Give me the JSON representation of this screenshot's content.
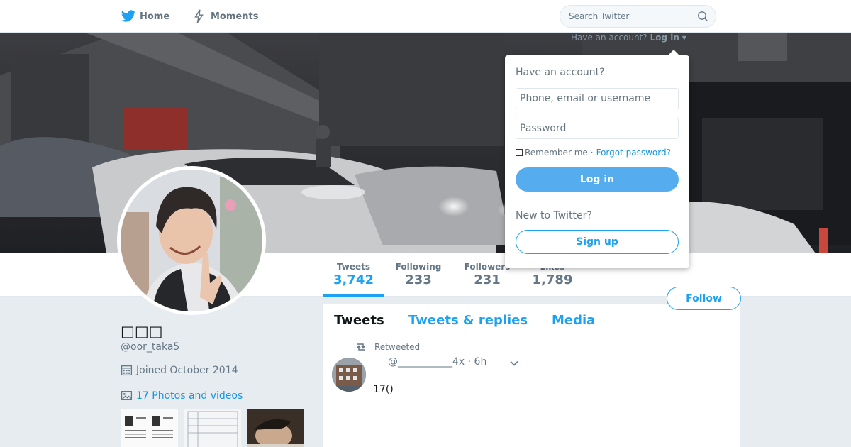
{
  "nav": {
    "home_label": "Home",
    "moments_label": "Moments",
    "search_placeholder": "Search Twitter",
    "login_prompt": "Have an account?",
    "login_link": "Log in"
  },
  "profile": {
    "name": "□□□",
    "handle": "@oor_taka5",
    "joined": "Joined October 2014",
    "photos_link": "17 Photos and videos",
    "follow_label": "Follow"
  },
  "stats": [
    {
      "label": "Tweets",
      "value": "3,742"
    },
    {
      "label": "Following",
      "value": "233"
    },
    {
      "label": "Followers",
      "value": "231"
    },
    {
      "label": "Likes",
      "value": "1,789"
    }
  ],
  "timeline": {
    "tabs": [
      "Tweets",
      "Tweets & replies",
      "Media"
    ],
    "tweet": {
      "retweet_label": "Retweeted",
      "handle": "@___________4x",
      "time": "· 6h",
      "text": "17()"
    }
  },
  "login_dropdown": {
    "heading": "Have an account?",
    "username_placeholder": "Phone, email or username",
    "password_placeholder": "Password",
    "remember_label": "Remember me",
    "separator": "·",
    "forgot_label": "Forgot password?",
    "login_button": "Log in",
    "new_heading": "New to Twitter?",
    "signup_button": "Sign up"
  },
  "colors": {
    "accent": "#1da1f2",
    "login_button": "#55acee",
    "page_bg": "#e6ecf0"
  },
  "icons": [
    "twitter-bird-icon",
    "lightning-icon",
    "search-icon",
    "calendar-icon",
    "photo-icon",
    "retweet-icon",
    "chevron-down-icon"
  ]
}
